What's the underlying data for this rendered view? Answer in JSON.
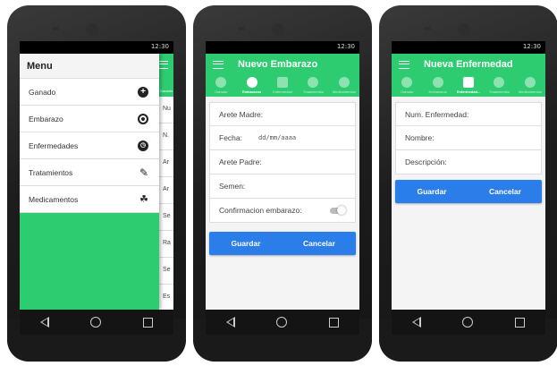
{
  "status": {
    "time": "12:30"
  },
  "phone1": {
    "menu_title": "Menu",
    "items": [
      {
        "label": "Ganado",
        "icon": "plus-circle-icon"
      },
      {
        "label": "Embarazo",
        "icon": "record-circle-icon"
      },
      {
        "label": "Enfermedades",
        "icon": "clock-icon"
      },
      {
        "label": "Tratamientos",
        "icon": "edit-icon"
      },
      {
        "label": "Medicamentos",
        "icon": "cluster-icon"
      }
    ],
    "behind_tab": "Ganado",
    "behind_rows": [
      "Nu",
      "N.",
      "Ar",
      "Ar",
      "Se",
      "Ra",
      "Se",
      "Es"
    ]
  },
  "tabs": [
    "Ganado",
    "Embarazos",
    "Enfermedad",
    "Tratamientos",
    "Medicamentos"
  ],
  "phone2": {
    "title": "Nuevo Embarazo",
    "fields": {
      "arete_madre": "Arete Madre:",
      "fecha": "Fecha:",
      "fecha_placeholder": "dd/mm/aaaa",
      "arete_padre": "Arete Padre:",
      "semen": "Semen:",
      "confirmacion": "Confirmacion embarazo:"
    },
    "save": "Guardar",
    "cancel": "Cancelar"
  },
  "phone3": {
    "title": "Nueva Enfermedad",
    "tabs": [
      "Ganado",
      "Embarazos",
      "Enfermedad...",
      "Tratamientos",
      "Medicamentos"
    ],
    "fields": [
      "Num. Enfermedad:",
      "Nombre:",
      "Descripción:"
    ],
    "save": "Guardar",
    "cancel": "Cancelar"
  },
  "colors": {
    "green": "#2ecc71",
    "blue": "#2b7de9"
  }
}
